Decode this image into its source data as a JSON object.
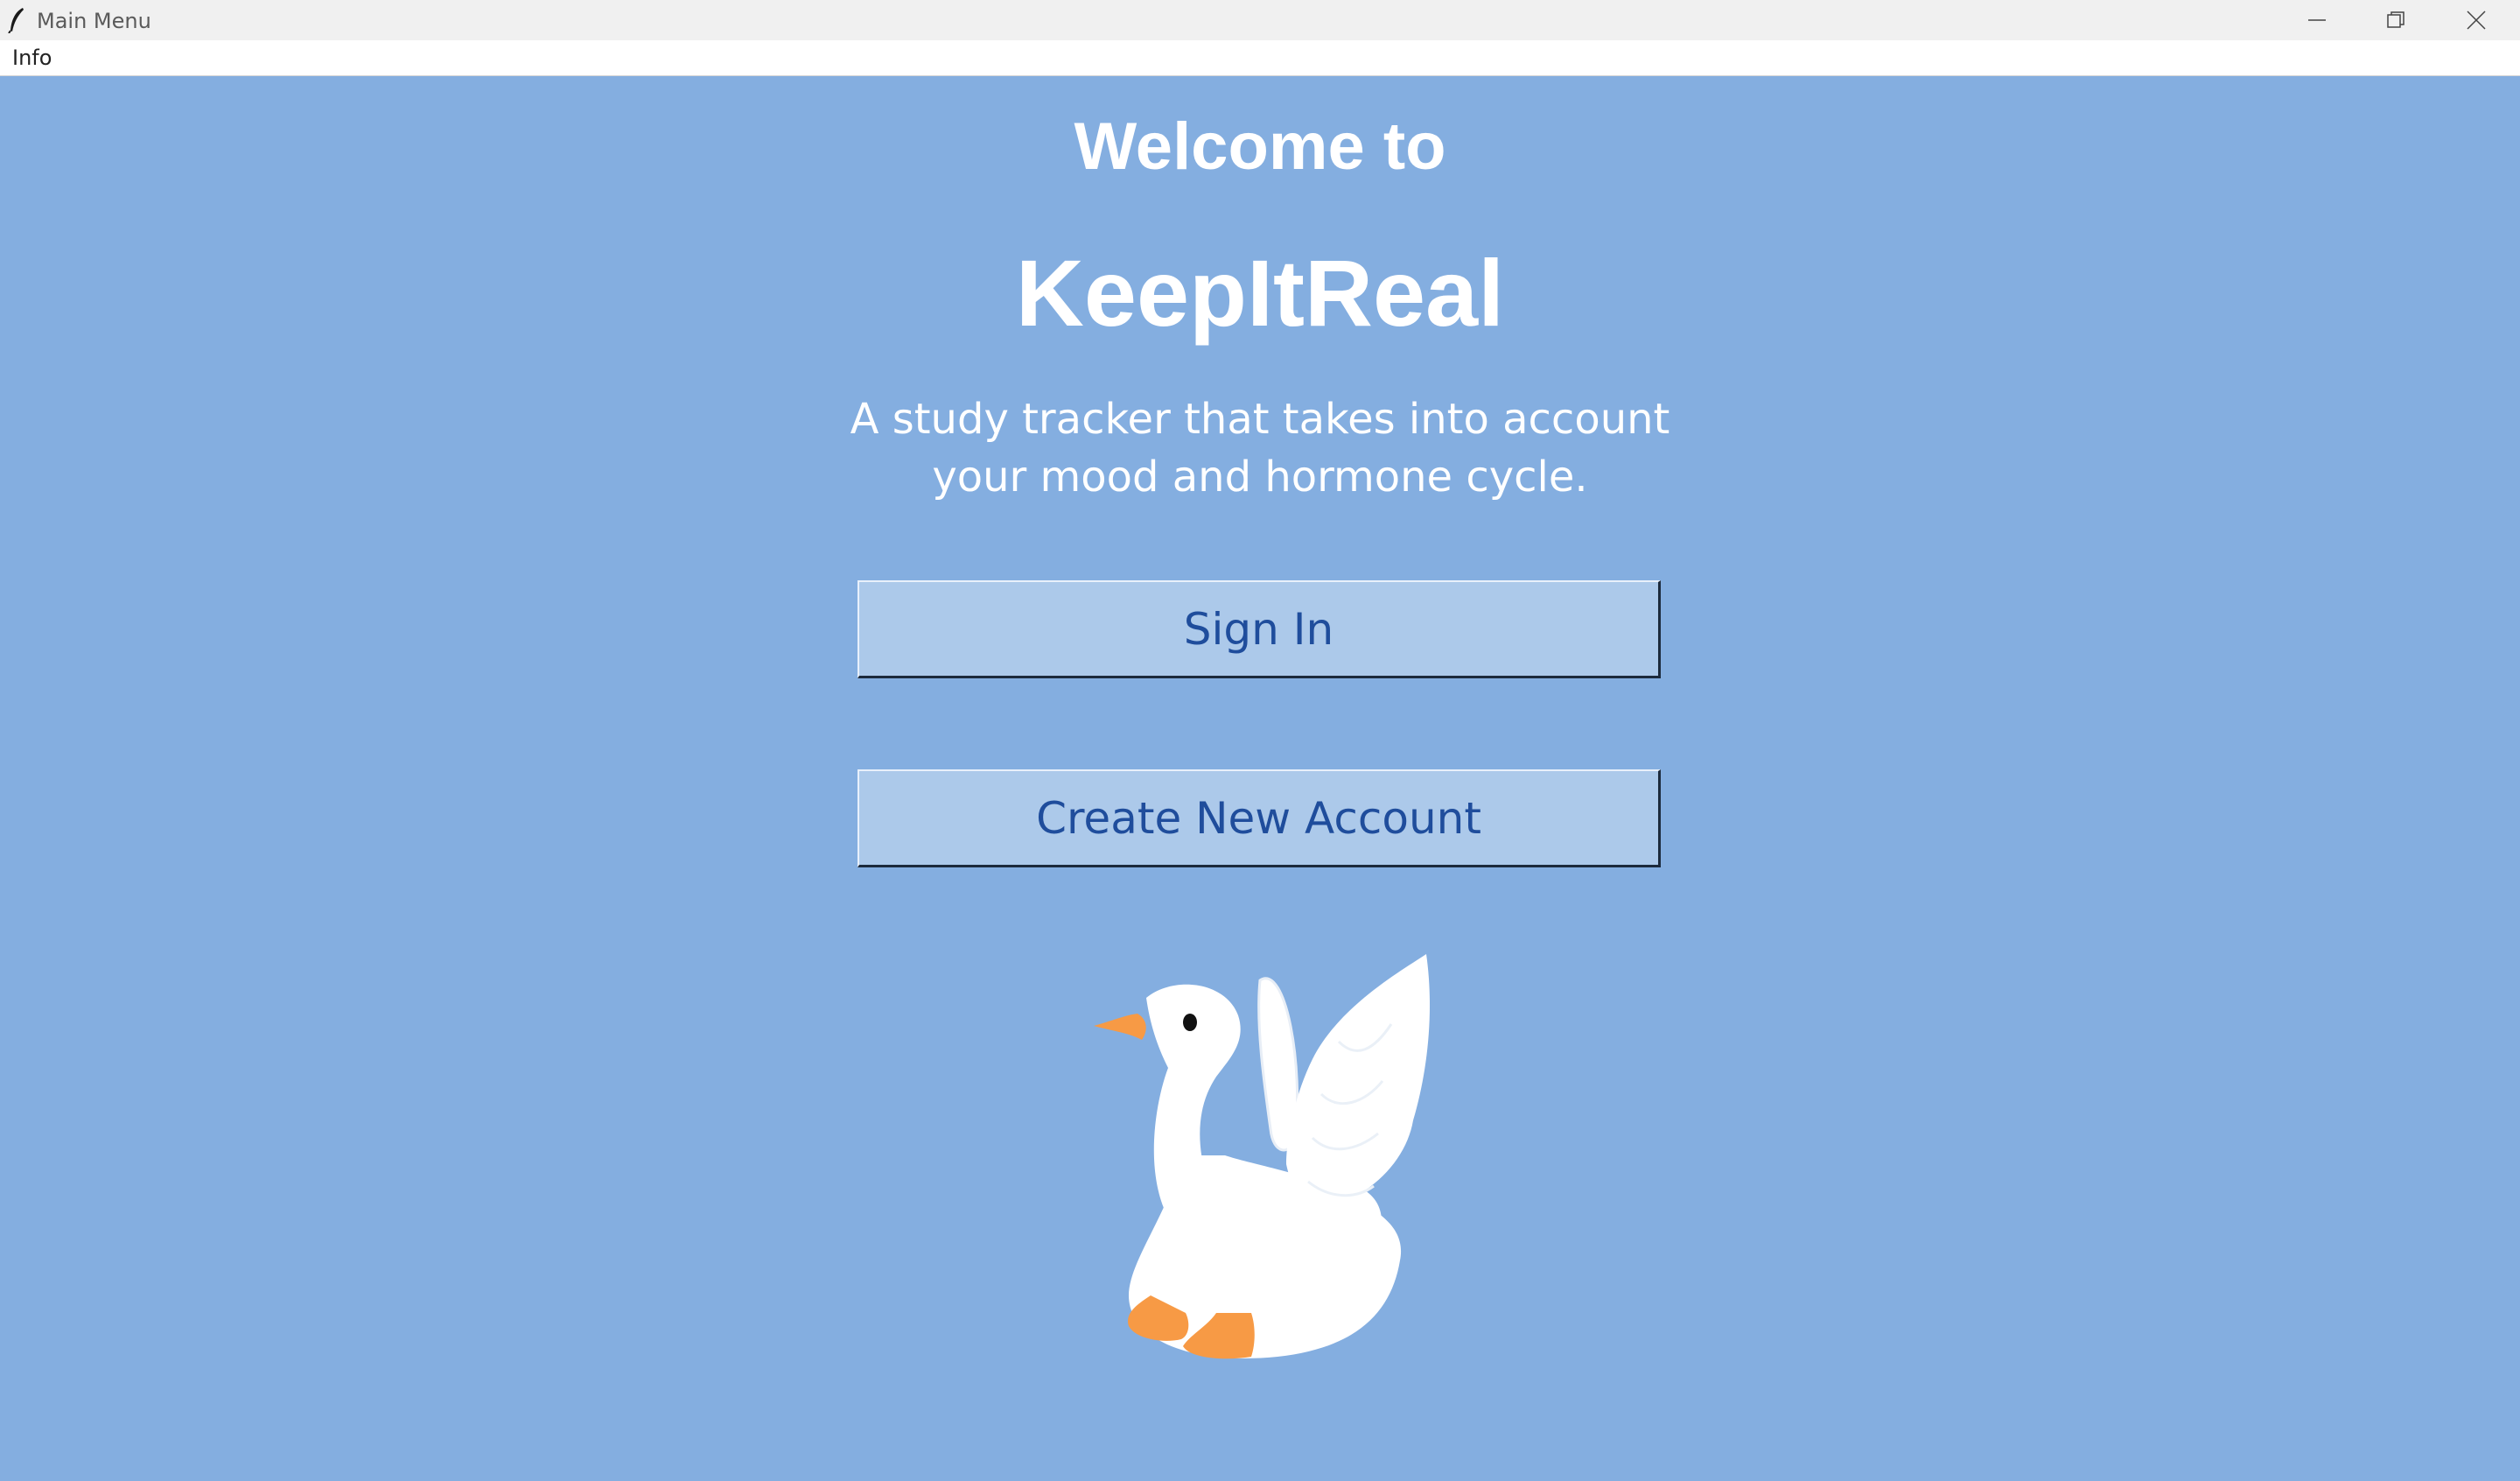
{
  "window": {
    "title": "Main Menu",
    "icon": "feather-icon"
  },
  "menubar": {
    "items": [
      {
        "label": "Info"
      }
    ]
  },
  "content": {
    "welcome": "Welcome to",
    "app_name": "KeepItReal",
    "tagline": "A study tracker that takes into account\n  your mood and hormone cycle.",
    "buttons": {
      "sign_in": "Sign In",
      "create_account": "Create New Account"
    },
    "mascot": "goose-illustration"
  },
  "colors": {
    "background": "#84aee0",
    "button_bg": "#acc9ea",
    "button_text": "#1f4d9c",
    "heading_text": "#ffffff",
    "goose_feet": "#f79a45"
  }
}
